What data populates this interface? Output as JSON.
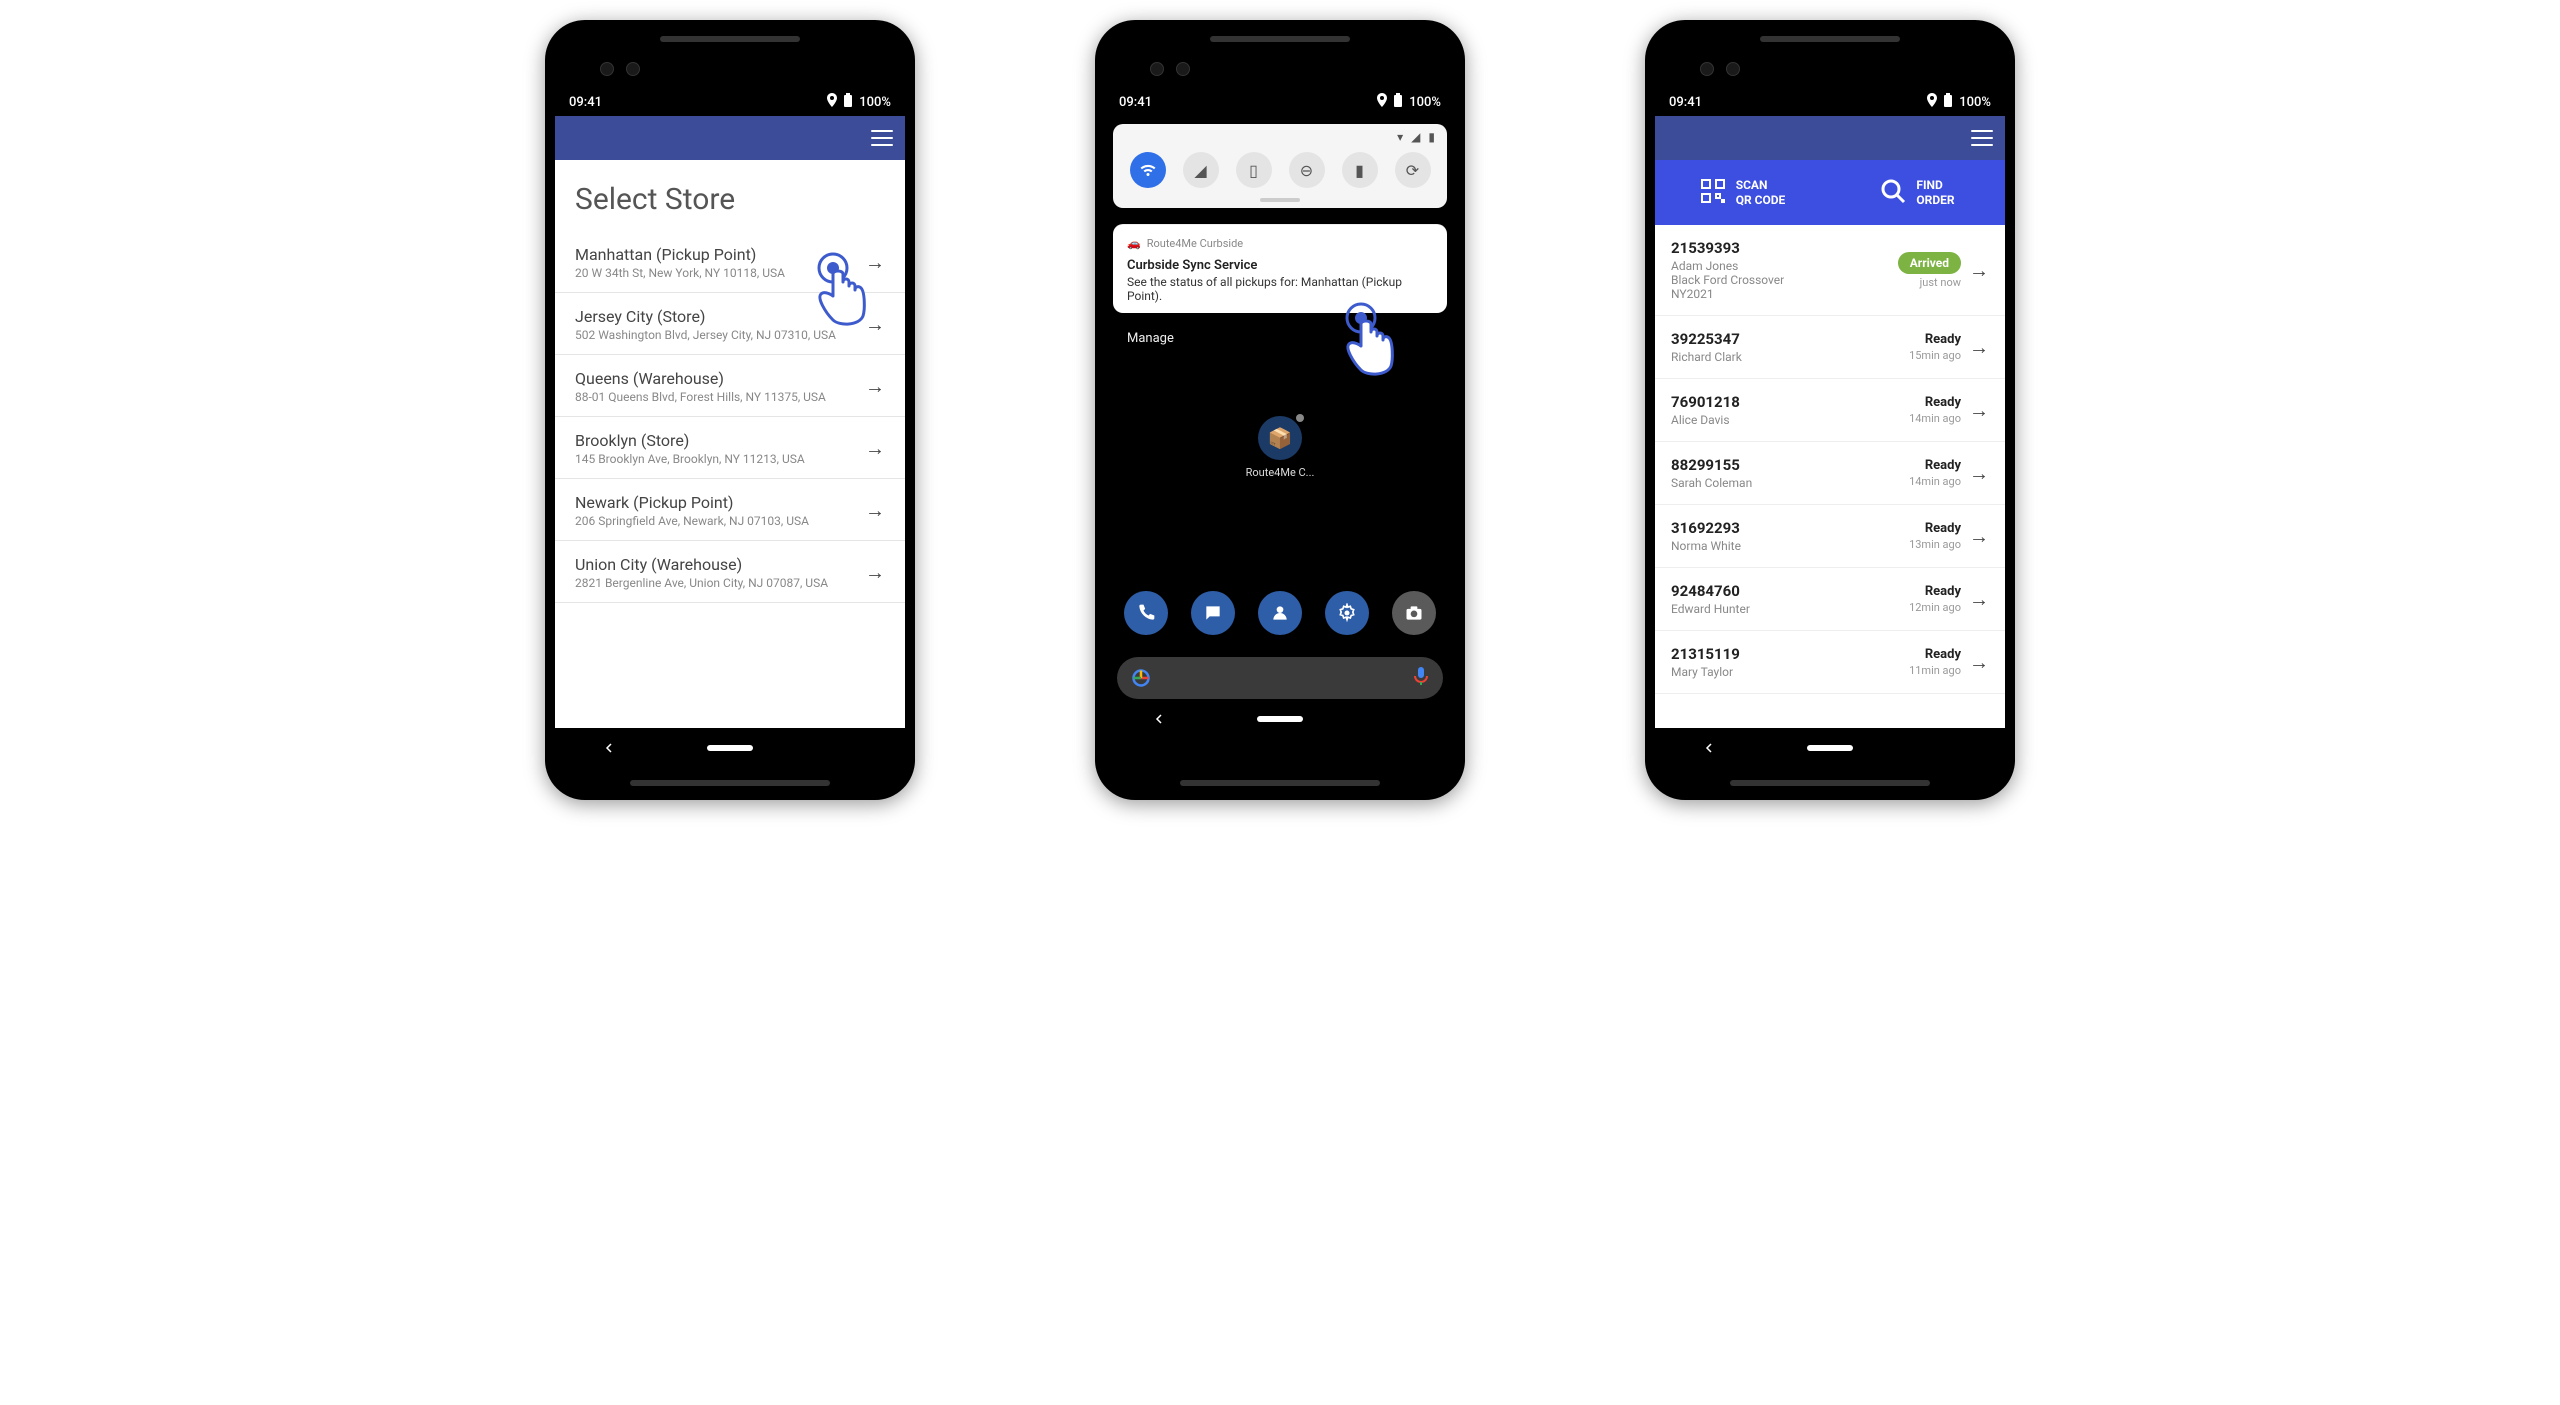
{
  "status": {
    "time": "09:41",
    "battery": "100%"
  },
  "phone1": {
    "title": "Select Store",
    "stores": [
      {
        "name": "Manhattan (Pickup Point)",
        "addr": "20 W 34th St, New York, NY 10118, USA"
      },
      {
        "name": "Jersey City (Store)",
        "addr": "502 Washington Blvd, Jersey City, NJ 07310, USA"
      },
      {
        "name": "Queens (Warehouse)",
        "addr": "88-01 Queens Blvd, Forest Hills, NY 11375, USA"
      },
      {
        "name": "Brooklyn (Store)",
        "addr": "145 Brooklyn Ave, Brooklyn, NY 11213, USA"
      },
      {
        "name": "Newark (Pickup Point)",
        "addr": "206 Springfield Ave, Newark, NJ 07103, USA"
      },
      {
        "name": "Union City (Warehouse)",
        "addr": "2821 Bergenline Ave, Union City, NJ 07087, USA"
      }
    ]
  },
  "phone2": {
    "notif_app": "Route4Me Curbside",
    "notif_title": "Curbside Sync Service",
    "notif_body": "See the status of all pickups for: Manhattan (Pickup Point).",
    "manage": "Manage",
    "app_label": "Route4Me C..."
  },
  "phone3": {
    "scan_line1": "SCAN",
    "scan_line2": "QR CODE",
    "find_line1": "FIND",
    "find_line2": "ORDER",
    "orders": [
      {
        "id": "21539393",
        "name": "Adam Jones",
        "detail1": "Black Ford Crossover",
        "detail2": "NY2021",
        "status": "Arrived",
        "badge": true,
        "time": "just now"
      },
      {
        "id": "39225347",
        "name": "Richard Clark",
        "status": "Ready",
        "time": "15min ago"
      },
      {
        "id": "76901218",
        "name": "Alice Davis",
        "status": "Ready",
        "time": "14min ago"
      },
      {
        "id": "88299155",
        "name": "Sarah Coleman",
        "status": "Ready",
        "time": "14min ago"
      },
      {
        "id": "31692293",
        "name": "Norma White",
        "status": "Ready",
        "time": "13min ago"
      },
      {
        "id": "92484760",
        "name": "Edward Hunter",
        "status": "Ready",
        "time": "12min ago"
      },
      {
        "id": "21315119",
        "name": "Mary Taylor",
        "status": "Ready",
        "time": "11min ago"
      }
    ]
  }
}
